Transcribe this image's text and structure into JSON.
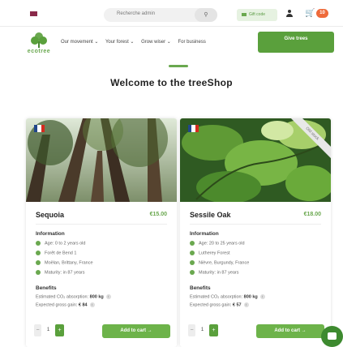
{
  "topbar": {
    "flag_icon": "flag-icon",
    "search_placeholder": "Recherche admin",
    "search_icon": "search-icon",
    "giftcode_label": "Gift code",
    "user_icon": "user-icon",
    "cart_icon": "cart-icon",
    "cart_count": "10"
  },
  "nav": {
    "logo_text": "ecotree",
    "menu": [
      "Our movement ⌄",
      "Your forest ⌄",
      "Grow wiser ⌄",
      "For business"
    ],
    "give_button": "Give trees"
  },
  "main": {
    "title": "Welcome to the treeShop"
  },
  "cards": [
    {
      "name": "Sequoia",
      "price": "€15.00",
      "ribbon": "",
      "flag_colors": [
        "#21468b",
        "#ffffff",
        "#d52b1e"
      ],
      "info_title": "Information",
      "info": [
        {
          "icon": "clock-icon",
          "text": "Age: 0 to 2 years old"
        },
        {
          "icon": "tree-icon",
          "text": "Forêt de Bend 1"
        },
        {
          "icon": "location-icon",
          "text": "Moëlan, Brittany, France"
        },
        {
          "icon": "calendar-icon",
          "text": "Maturity: in 87 years"
        }
      ],
      "benefits_title": "Benefits",
      "benefits": [
        {
          "label": "Estimated CO₂ absorption:",
          "value": "800 kg"
        },
        {
          "label": "Expected gross gain:",
          "value": "€ 84"
        }
      ],
      "qty_minus": "−",
      "qty_value": "1",
      "qty_plus": "+",
      "add_to_cart": "Add to cart →"
    },
    {
      "name": "Sessile Oak",
      "price": "€18.00",
      "ribbon": "Old stock",
      "flag_colors": [
        "#21468b",
        "#ffffff",
        "#d52b1e"
      ],
      "info_title": "Information",
      "info": [
        {
          "icon": "clock-icon",
          "text": "Age: 20 to 25 years old"
        },
        {
          "icon": "tree-icon",
          "text": "Lutherey Forest"
        },
        {
          "icon": "location-icon",
          "text": "Nièvre, Burgundy, France"
        },
        {
          "icon": "calendar-icon",
          "text": "Maturity: in 87 years"
        }
      ],
      "benefits_title": "Benefits",
      "benefits": [
        {
          "label": "Estimated CO₂ absorption:",
          "value": "800 kg"
        },
        {
          "label": "Expected gross gain:",
          "value": "€ 57"
        }
      ],
      "qty_minus": "−",
      "qty_value": "1",
      "qty_plus": "+",
      "add_to_cart": "Add to cart →"
    }
  ],
  "chat": {
    "icon": "chat-icon"
  },
  "colors": {
    "accent": "#6aa84f",
    "accent_dark": "#5aa03c",
    "badge": "#ee6a3a"
  }
}
